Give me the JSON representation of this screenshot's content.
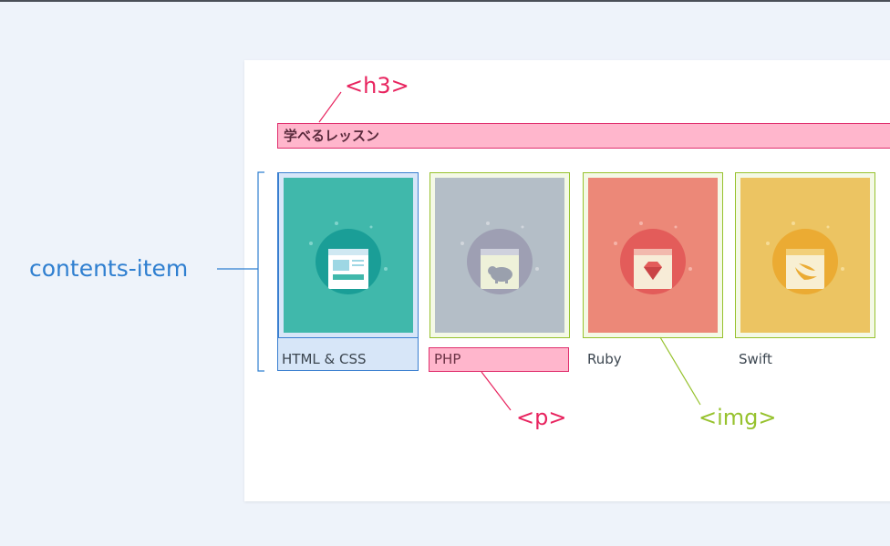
{
  "heading": "学べるレッスン",
  "annotations": {
    "h3": "<h3>",
    "contents_item": "contents-item",
    "p": "<p>",
    "img": "<img>"
  },
  "items": [
    {
      "label": "HTML & CSS",
      "color": "#40b8ab",
      "circle": "#1a9e97",
      "icon": "browser-icon"
    },
    {
      "label": "PHP",
      "color": "#b4bec7",
      "circle": "#9e9fb3",
      "icon": "elephant-icon"
    },
    {
      "label": "Ruby",
      "color": "#ec8878",
      "circle": "#e35c5a",
      "icon": "ruby-gem-icon"
    },
    {
      "label": "Swift",
      "color": "#ecc462",
      "circle": "#ebab33",
      "icon": "swift-bird-icon"
    }
  ],
  "colors": {
    "h3_highlight": "#ffb6cc",
    "contents_item_highlight": "#d7e6f8",
    "img_outline": "#97c22e",
    "pink_annotation": "#e8245f",
    "blue_annotation": "#2f7fd0"
  }
}
